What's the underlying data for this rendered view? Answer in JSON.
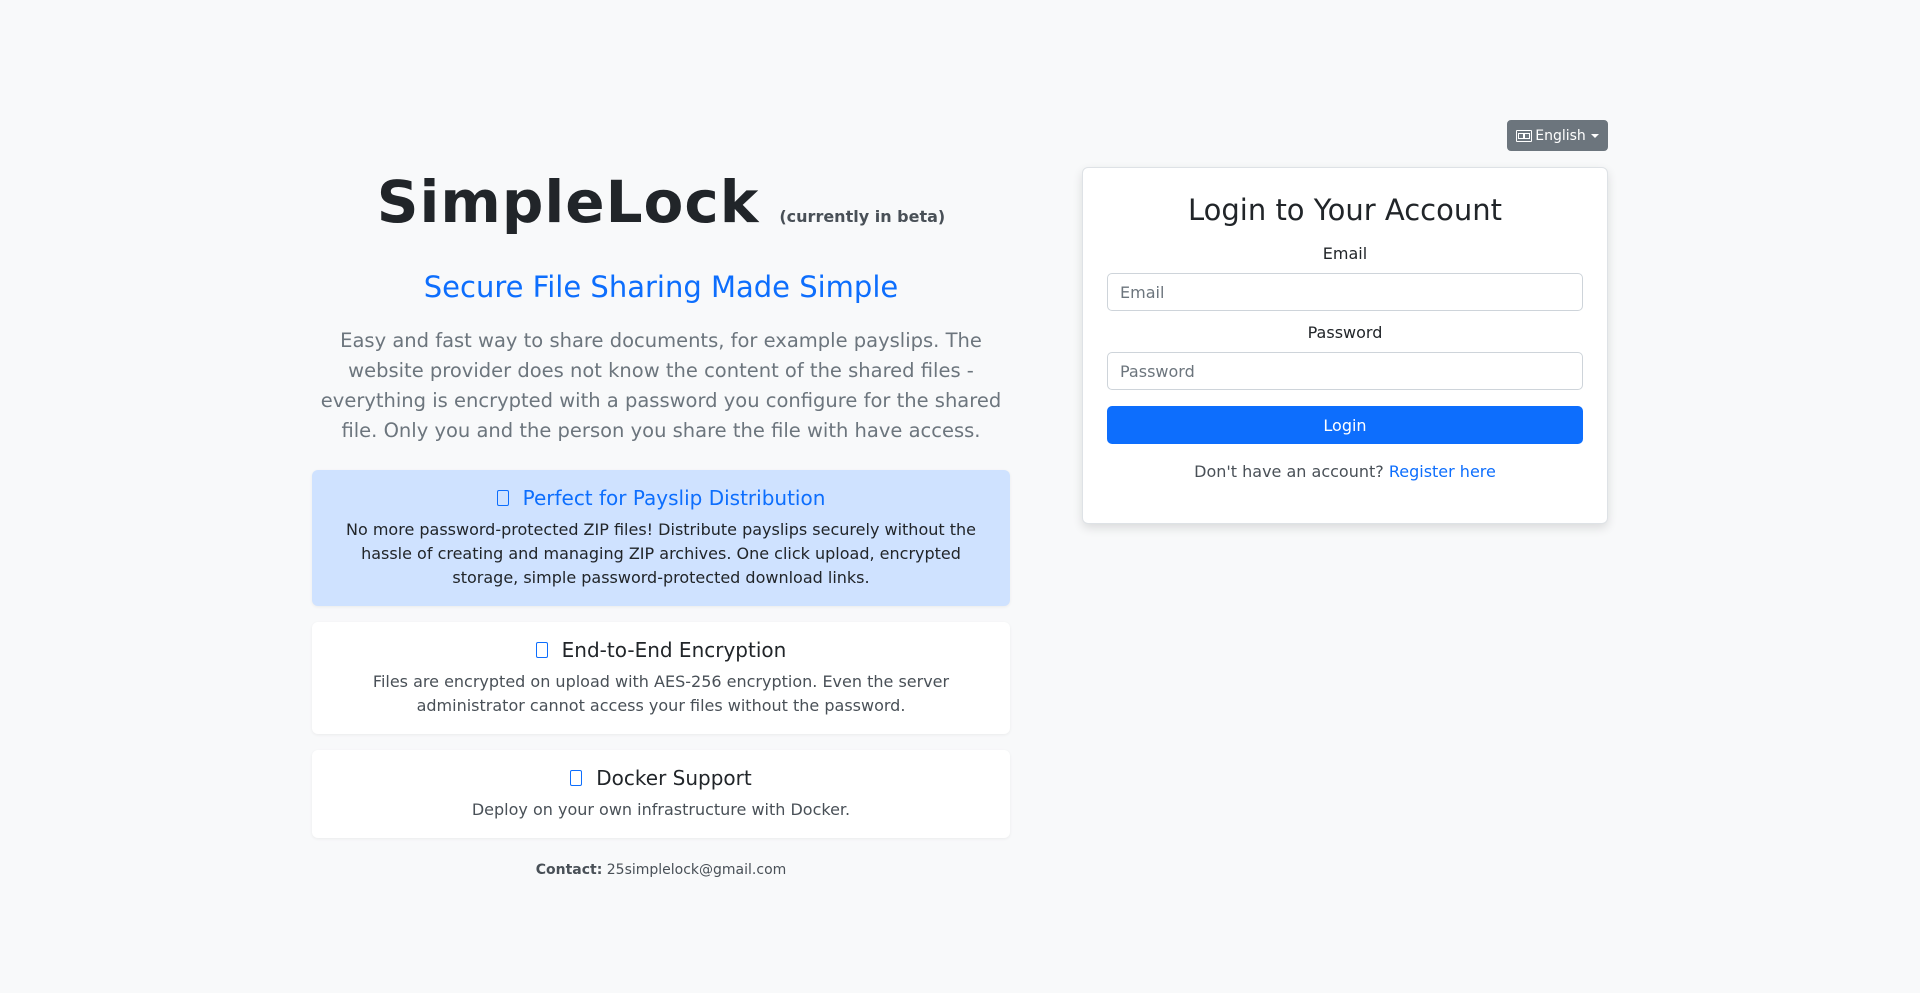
{
  "language": {
    "label": "English",
    "icon": "flag-icon"
  },
  "hero": {
    "title": "SimpleLock",
    "beta": "(currently in beta)",
    "tagline": "Secure File Sharing Made Simple",
    "description": "Easy and fast way to share documents, for example payslips. The website provider does not know the content of the shared files - everything is encrypted with a password you configure for the shared file. Only you and the person you share the file with have access."
  },
  "features": [
    {
      "icon": "document-icon",
      "title": "Perfect for Payslip Distribution",
      "body": "No more password-protected ZIP files! Distribute payslips securely without the hassle of creating and managing ZIP archives. One click upload, encrypted storage, simple password-protected download links."
    },
    {
      "icon": "lock-icon",
      "title": "End-to-End Encryption",
      "body": "Files are encrypted on upload with AES-256 encryption. Even the server administrator cannot access your files without the password."
    },
    {
      "icon": "docker-icon",
      "title": "Docker Support",
      "body": "Deploy on your own infrastructure with Docker."
    }
  ],
  "contact": {
    "label": "Contact:",
    "email": "25simplelock@gmail.com"
  },
  "login": {
    "title": "Login to Your Account",
    "email_label": "Email",
    "email_placeholder": "Email",
    "email_value": "",
    "password_label": "Password",
    "password_placeholder": "Password",
    "password_value": "",
    "button": "Login",
    "no_account": "Don't have an account?",
    "register_link": "Register here"
  },
  "colors": {
    "primary": "#0d6efd",
    "highlight_bg": "#cfe2ff",
    "secondary_btn": "#6c757d",
    "page_bg": "#f8f9fa"
  }
}
